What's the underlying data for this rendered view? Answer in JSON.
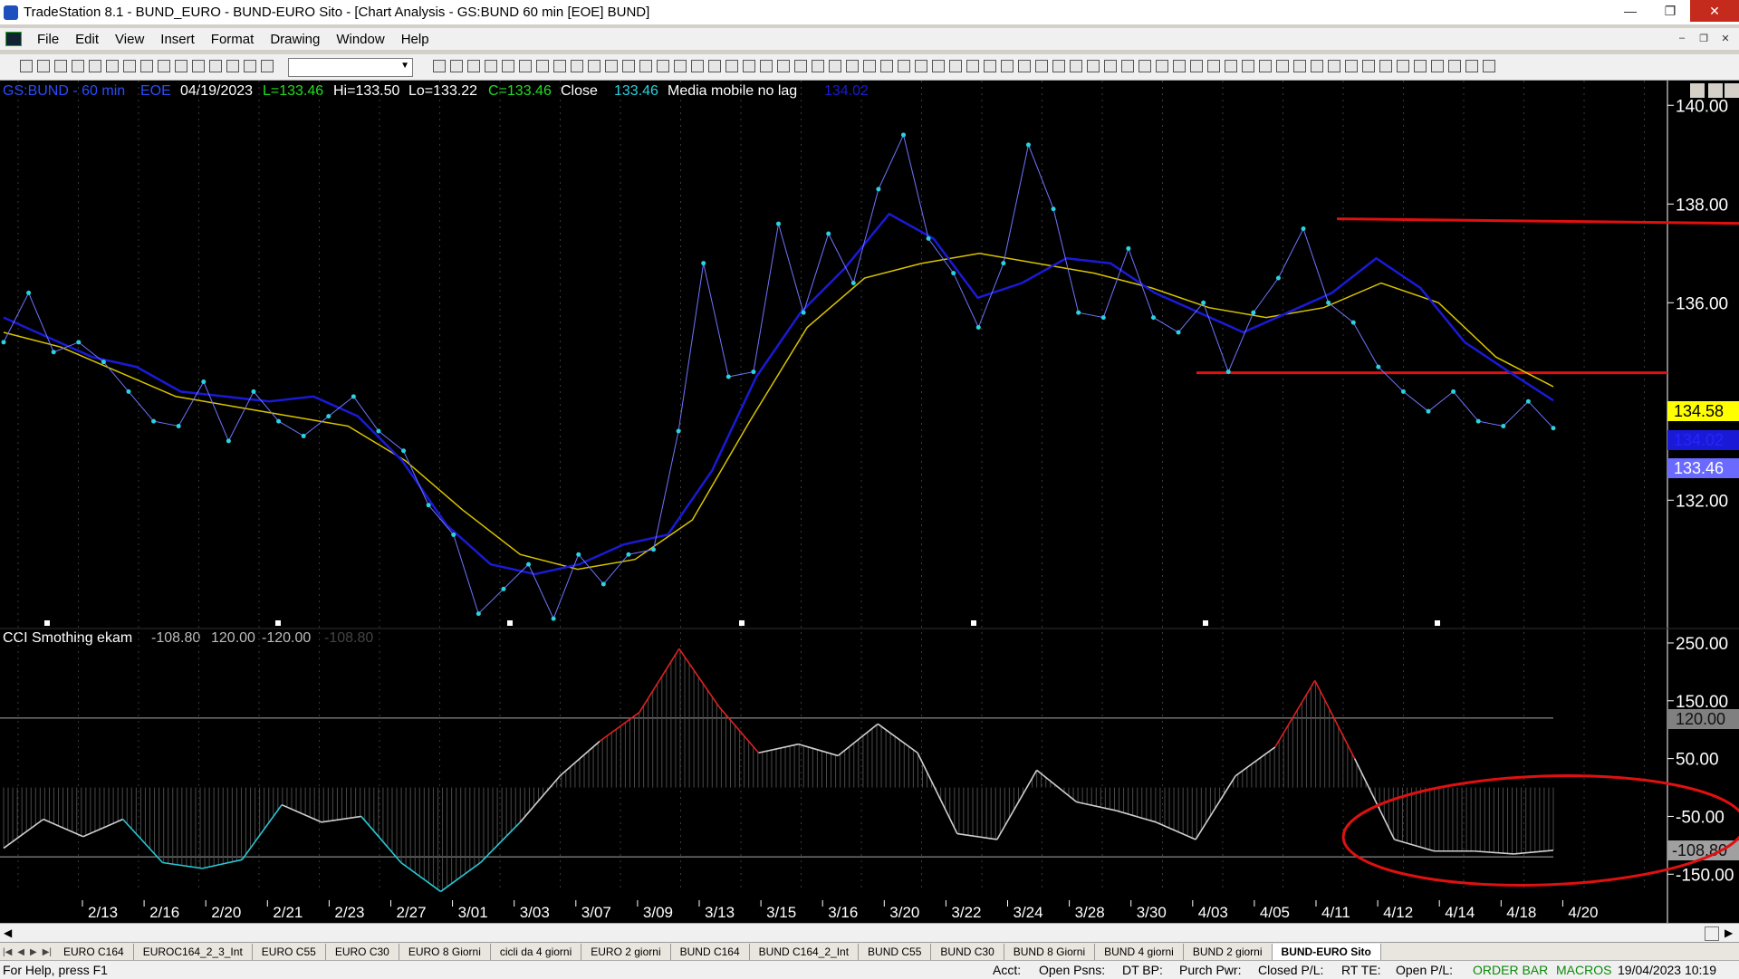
{
  "window": {
    "title": "TradeStation 8.1 - BUND_EURO - BUND-EURO Sito - [Chart Analysis - GS:BUND  60 min  [EOE] BUND]"
  },
  "menu": [
    "File",
    "Edit",
    "View",
    "Insert",
    "Format",
    "Drawing",
    "Window",
    "Help"
  ],
  "chart_header": {
    "symbol": "GS:BUND - 60 min",
    "exchange": "EOE",
    "date": "04/19/2023",
    "low": "L=133.46",
    "high": "Hi=133.50",
    "lo": "Lo=133.22",
    "close": "C=133.46",
    "close_label": "Close",
    "close_value": "133.46",
    "indicator": "Media mobile no lag",
    "indicator_value": "134.02"
  },
  "sub_header": {
    "name": "CCI Smothing ekam",
    "v1": "-108.80",
    "v2": "120.00",
    "v3": "-120.00",
    "v4": "-108.80"
  },
  "price_markers": {
    "yellow": "134.58",
    "blue": "134.02",
    "close": "133.46"
  },
  "cci_markers": {
    "upper": "120.00",
    "current": "-108.80"
  },
  "tabs": [
    "EURO C164",
    "EUROC164_2_3_Int",
    "EURO C55",
    "EURO C30",
    "EURO 8 Giorni",
    "cicli da 4 giorni",
    "EURO 2 giorni",
    "BUND C164",
    "BUND C164_2_Int",
    "BUND C55",
    "BUND  C30",
    "BUND 8 Giorni",
    "BUND 4 giorni",
    "BUND 2 giorni",
    "BUND-EURO Sito"
  ],
  "active_tab": "BUND-EURO Sito",
  "status": {
    "help": "For Help, press F1",
    "acct": "Acct:",
    "open_psns": "Open Psns:",
    "dt_bp": "DT BP:",
    "purch_pwr": "Purch Pwr:",
    "closed_pl": "Closed P/L:",
    "rt_te": "RT TE:",
    "open_pl": "Open P/L:",
    "order_bar": "ORDER BAR",
    "macros": "MACROS",
    "datetime": "19/04/2023 10:19"
  },
  "chart_data": [
    {
      "type": "line",
      "title": "GS:BUND - 60 min",
      "x": [
        "2/13",
        "2/16",
        "2/20",
        "2/21",
        "2/23",
        "2/27",
        "3/01",
        "3/03",
        "3/07",
        "3/09",
        "3/13",
        "3/15",
        "3/16",
        "3/20",
        "3/22",
        "3/24",
        "3/28",
        "3/30",
        "4/03",
        "4/05",
        "4/11",
        "4/12",
        "4/14",
        "4/18",
        "4/20"
      ],
      "y_ticks": [
        "140.00",
        "138.00",
        "136.00",
        "132.00"
      ],
      "ylim": [
        129.4,
        140.5
      ],
      "colors": {
        "price": "#29d3e0",
        "ma_fast": "#1a1ad6",
        "ma_slow": "#d9c400",
        "level": "#e01010"
      },
      "series": [
        {
          "name": "Close",
          "values": [
            135.2,
            136.2,
            135.0,
            135.2,
            134.8,
            134.2,
            133.6,
            133.5,
            134.4,
            133.2,
            134.2,
            133.6,
            133.3,
            133.7,
            134.1,
            133.4,
            133.0,
            131.9,
            131.3,
            129.7,
            130.2,
            130.7,
            129.6,
            130.9,
            130.3,
            130.9,
            131.0,
            133.4,
            136.8,
            134.5,
            134.6,
            137.6,
            135.8,
            137.4,
            136.4,
            138.3,
            139.4,
            137.3,
            136.6,
            135.5,
            136.8,
            139.2,
            137.9,
            135.8,
            135.7,
            137.1,
            135.7,
            135.4,
            136.0,
            134.6,
            135.8,
            136.5,
            137.5,
            136.0,
            135.6,
            134.7,
            134.2,
            133.8,
            134.2,
            133.6,
            133.5,
            134.0,
            133.46
          ],
          "date_index": [
            0,
            1,
            2,
            3,
            4,
            5,
            6,
            7,
            8,
            9,
            10,
            11,
            12,
            13,
            14,
            15,
            16,
            17,
            18,
            19,
            20,
            21,
            22,
            23,
            24
          ]
        },
        {
          "name": "Media mobile no lag",
          "values": [
            135.7,
            135.3,
            134.9,
            134.7,
            134.2,
            134.1,
            134.0,
            134.1,
            133.7,
            132.8,
            131.5,
            130.7,
            130.5,
            130.7,
            131.1,
            131.3,
            132.6,
            134.5,
            135.8,
            136.7,
            137.8,
            137.3,
            136.1,
            136.4,
            136.9,
            136.8,
            136.2,
            135.8,
            135.4,
            135.8,
            136.2,
            136.9,
            136.3,
            135.2,
            134.6,
            134.02
          ]
        },
        {
          "name": "Average",
          "values": [
            135.4,
            135.1,
            134.6,
            134.1,
            133.9,
            133.7,
            133.5,
            132.8,
            131.8,
            130.9,
            130.6,
            130.8,
            131.6,
            133.6,
            135.5,
            136.5,
            136.8,
            137.0,
            136.8,
            136.6,
            136.3,
            135.9,
            135.7,
            135.9,
            136.4,
            136.0,
            134.9,
            134.3
          ]
        }
      ],
      "levels": [
        137.7,
        134.58
      ]
    },
    {
      "type": "area",
      "title": "CCI Smothing ekam",
      "y_ticks": [
        "250.00",
        "150.00",
        "50.00",
        "-50.00",
        "-150.00"
      ],
      "ylim": [
        -195,
        275
      ],
      "thresholds": [
        120,
        -120
      ],
      "series": [
        {
          "name": "CCI Smothing ekam",
          "values": [
            -105,
            -55,
            -85,
            -55,
            -130,
            -140,
            -125,
            -30,
            -60,
            -50,
            -130,
            -180,
            -130,
            -60,
            20,
            80,
            130,
            240,
            140,
            60,
            75,
            55,
            110,
            60,
            -80,
            -90,
            30,
            -25,
            -40,
            -60,
            -90,
            20,
            70,
            185,
            50,
            -90,
            -110,
            -110,
            -115,
            -108.8
          ]
        }
      ]
    }
  ]
}
